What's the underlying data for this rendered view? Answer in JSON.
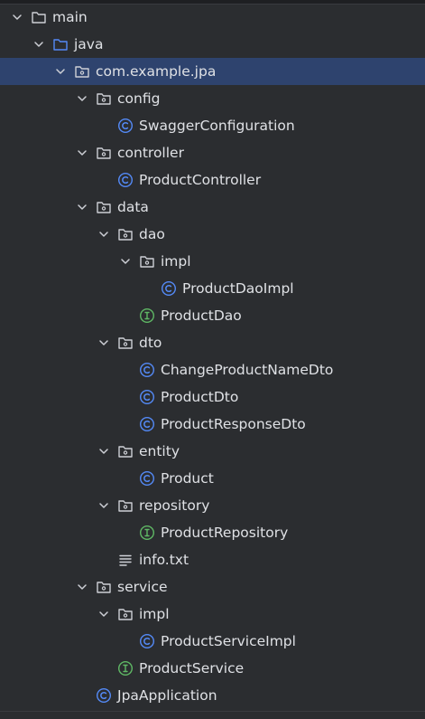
{
  "project_tree": {
    "items": [
      {
        "label": "main",
        "icon": "folder-icon",
        "expanded": true
      },
      {
        "label": "java",
        "icon": "source-folder-icon",
        "expanded": true
      },
      {
        "label": "com.example.jpa",
        "icon": "package-icon",
        "expanded": true,
        "selected": true
      },
      {
        "label": "config",
        "icon": "package-icon",
        "expanded": true
      },
      {
        "label": "SwaggerConfiguration",
        "icon": "class-icon"
      },
      {
        "label": "controller",
        "icon": "package-icon",
        "expanded": true
      },
      {
        "label": "ProductController",
        "icon": "class-icon"
      },
      {
        "label": "data",
        "icon": "package-icon",
        "expanded": true
      },
      {
        "label": "dao",
        "icon": "package-icon",
        "expanded": true
      },
      {
        "label": "impl",
        "icon": "package-icon",
        "expanded": true
      },
      {
        "label": "ProductDaoImpl",
        "icon": "class-icon"
      },
      {
        "label": "ProductDao",
        "icon": "interface-icon"
      },
      {
        "label": "dto",
        "icon": "package-icon",
        "expanded": true
      },
      {
        "label": "ChangeProductNameDto",
        "icon": "class-icon"
      },
      {
        "label": "ProductDto",
        "icon": "class-icon"
      },
      {
        "label": "ProductResponseDto",
        "icon": "class-icon"
      },
      {
        "label": "entity",
        "icon": "package-icon",
        "expanded": true
      },
      {
        "label": "Product",
        "icon": "class-icon"
      },
      {
        "label": "repository",
        "icon": "package-icon",
        "expanded": true
      },
      {
        "label": "ProductRepository",
        "icon": "interface-icon"
      },
      {
        "label": "info.txt",
        "icon": "text-file-icon"
      },
      {
        "label": "service",
        "icon": "package-icon",
        "expanded": true
      },
      {
        "label": "impl",
        "icon": "package-icon",
        "expanded": true
      },
      {
        "label": "ProductServiceImpl",
        "icon": "class-icon"
      },
      {
        "label": "ProductService",
        "icon": "interface-icon"
      },
      {
        "label": "JpaApplication",
        "icon": "class-icon"
      }
    ]
  },
  "colors": {
    "background": "#2b2d30",
    "selection": "#2e436e",
    "text": "#dfe1e5",
    "folder_stroke": "#ced0d6",
    "source_folder_stroke": "#548af7",
    "class_icon": "#548af7",
    "interface_icon": "#5fb865"
  }
}
